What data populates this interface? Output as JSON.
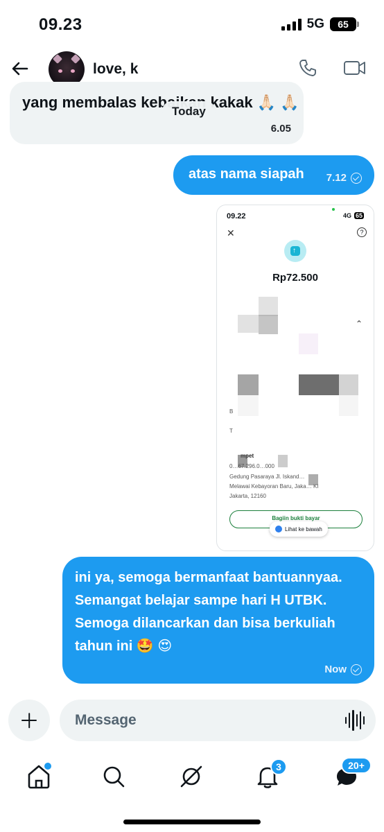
{
  "status_bar": {
    "time": "09.23",
    "network": "5G",
    "battery": "65"
  },
  "header": {
    "contact_name": "love, k"
  },
  "messages": {
    "received": {
      "text": "yang membalas kebaikan kakak 🙏🏻 🙏🏻",
      "time": "6.05"
    },
    "date_divider": "Today",
    "sent_1": {
      "text": "atas nama siapah",
      "time": "7.12"
    },
    "screenshot": {
      "time": "09.22",
      "network": "4G",
      "battery": "65",
      "amount": "Rp72.500",
      "label_b": "B",
      "label_to": "T",
      "label_mpet": "mpet",
      "number": "0…67.296.0…000",
      "address_1": "Gedung Pasaraya Jl. Iskand…",
      "address_2": "Melawai Kebayoran Baru, Jaka…     KI",
      "address_3": "Jakarta, 12160",
      "button": "Bagiin bukti bayar",
      "pill": "Lihat ke bawah"
    },
    "sent_2": {
      "text": "ini ya, semoga bermanfaat bantuannyaa. Semangat belajar sampe hari H UTBK. Semoga dilancarkan dan bisa berkuliah tahun ini 🤩 😍",
      "time": "Now"
    }
  },
  "composer": {
    "placeholder": "Message"
  },
  "nav": {
    "notifications_badge": "3",
    "messages_badge": "20+"
  },
  "colors": {
    "accent": "#1d9bf0",
    "bubble_received": "#eff3f4"
  }
}
